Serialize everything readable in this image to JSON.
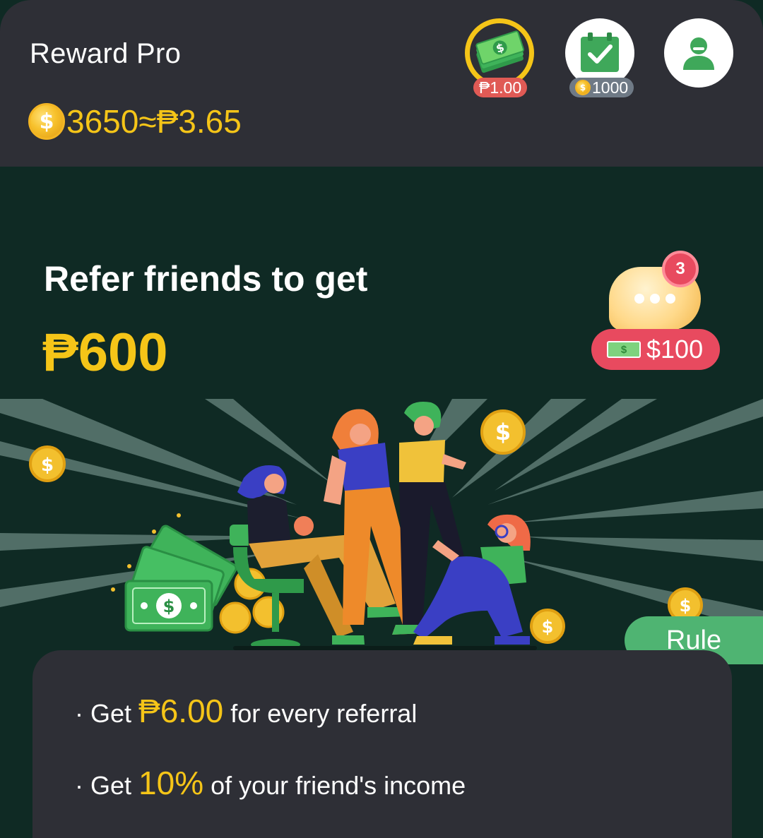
{
  "header": {
    "title": "Reward Pro",
    "balance_coins": "3650",
    "balance_approx": "≈₱3.65",
    "cash_badge": "₱1.00",
    "task_badge": "1000"
  },
  "icons": {
    "cash": "money-stack-icon",
    "task": "calendar-check-icon",
    "profile": "user-icon",
    "coin": "coin-icon",
    "chat": "chat-bubble-icon"
  },
  "hero": {
    "title": "Refer friends to get",
    "amount": "₱600",
    "notification_count": "3",
    "reward_amount": "$100"
  },
  "rule_label": "Rule",
  "rules": [
    {
      "prefix": "· Get ",
      "highlight": "₱6.00",
      "suffix": " for every referral"
    },
    {
      "prefix": "· Get ",
      "highlight": "10%",
      "suffix": " of your friend's income"
    }
  ],
  "colors": {
    "header_bg": "#2e2f36",
    "hero_bg": "#0f2a24",
    "accent_yellow": "#f5c518",
    "accent_red": "#e84a5f",
    "accent_green": "#4fb472"
  }
}
